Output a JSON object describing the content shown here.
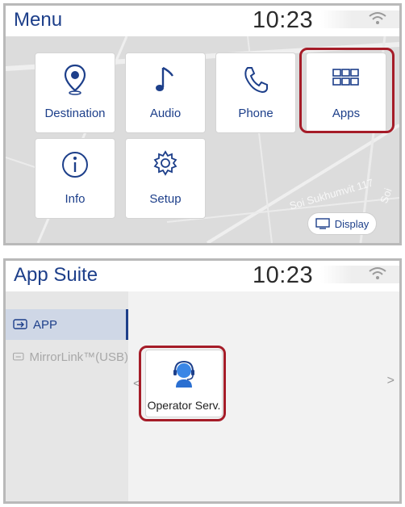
{
  "menu_screen": {
    "title": "Menu",
    "clock": "10:23",
    "tiles": [
      {
        "label": "Destination",
        "icon": "location-pin-icon"
      },
      {
        "label": "Audio",
        "icon": "music-note-icon"
      },
      {
        "label": "Phone",
        "icon": "phone-icon"
      },
      {
        "label": "Apps",
        "icon": "apps-grid-icon"
      },
      {
        "label": "Info",
        "icon": "info-icon"
      },
      {
        "label": "Setup",
        "icon": "gear-icon"
      }
    ],
    "display_button": "Display",
    "map_labels": [
      "Soi Sukhumvit 117",
      "Soi"
    ]
  },
  "app_suite_screen": {
    "title": "App Suite",
    "clock": "10:23",
    "sidebar": [
      {
        "label": "APP",
        "icon": "app-icon",
        "state": "active"
      },
      {
        "label": "MirrorLink™(USB)",
        "icon": "mirrorlink-icon",
        "state": "disabled"
      }
    ],
    "apps": [
      {
        "label": "Operator Serv.",
        "icon": "operator-headset-icon"
      }
    ]
  },
  "colors": {
    "label_blue": "#1d3f8a",
    "highlight_red": "#a51c28",
    "icon_blue": "#2a6fd1"
  }
}
